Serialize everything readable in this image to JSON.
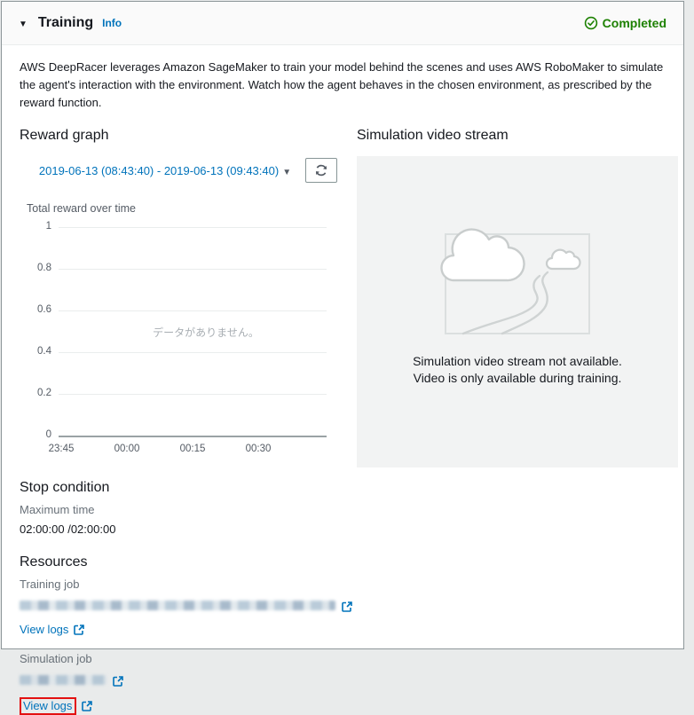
{
  "header": {
    "title": "Training",
    "info_label": "Info",
    "status_label": "Completed"
  },
  "description": "AWS DeepRacer leverages Amazon SageMaker to train your model behind the scenes and uses AWS RoboMaker to simulate the agent's interaction with the environment. Watch how the agent behaves in the chosen environment, as prescribed by the reward function.",
  "reward_graph": {
    "heading": "Reward graph",
    "date_range": "2019-06-13 (08:43:40) - 2019-06-13 (09:43:40)"
  },
  "chart_data": {
    "type": "line",
    "title": "Total reward over time",
    "series": [],
    "no_data_message": "データがありません。",
    "yticks": [
      "1",
      "0.8",
      "0.6",
      "0.4",
      "0.2",
      "0"
    ],
    "ylim": [
      0,
      1
    ],
    "xticks": [
      "23:45",
      "00:00",
      "00:15",
      "00:30"
    ],
    "grid": true,
    "legend": false
  },
  "video": {
    "heading": "Simulation video stream",
    "message_line1": "Simulation video stream not available.",
    "message_line2": "Video is only available during training."
  },
  "stop_condition": {
    "heading": "Stop condition",
    "label": "Maximum time",
    "value": "02:00:00 /02:00:00"
  },
  "resources": {
    "heading": "Resources",
    "training_job_label": "Training job",
    "training_job_redacted": true,
    "training_view_logs": "View logs",
    "simulation_job_label": "Simulation job",
    "simulation_job_redacted": true,
    "simulation_view_logs": "View logs"
  },
  "colors": {
    "link": "#0073bb",
    "success": "#1d8102",
    "highlight_red": "#e31111",
    "header_bg": "#fafafa",
    "video_bg": "#f2f3f3"
  }
}
